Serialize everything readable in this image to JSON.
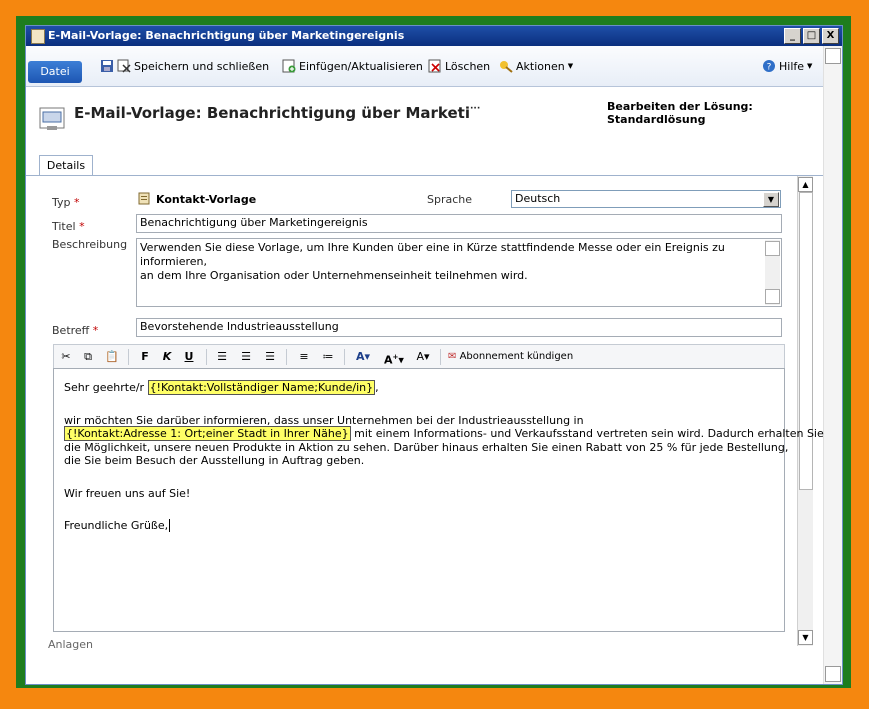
{
  "window": {
    "title": "E-Mail-Vorlage: Benachrichtigung über Marketingereignis",
    "controls": [
      "_",
      "□",
      "X"
    ]
  },
  "ribbon": {
    "file_tab": "Datei",
    "save_close": "Speichern und schließen",
    "insert_update": "Einfügen/Aktualisieren",
    "delete": "Löschen",
    "actions": "Aktionen",
    "help": "Hilfe"
  },
  "form": {
    "title": "E-Mail-Vorlage: Benachrichtigung über Marketi",
    "title_ellipsis": "···",
    "solution": "Bearbeiten der Lösung: Standardlösung",
    "tab": "Details"
  },
  "fields": {
    "type_label": "Typ",
    "type_value": "Kontakt-Vorlage",
    "language_label": "Sprache",
    "language_value": "Deutsch",
    "title_label": "Titel",
    "title_value": "Benachrichtigung über Marketingereignis",
    "description_label": "Beschreibung",
    "description_line1": "Verwenden Sie diese Vorlage, um Ihre Kunden über eine in Kürze stattfindende Messe oder ein Ereignis zu informieren,",
    "description_line2": "an dem Ihre Organisation oder Unternehmenseinheit teilnehmen wird.",
    "subject_label": "Betreff",
    "subject_value": "Bevorstehende Industrieausstellung",
    "required_marker": "*"
  },
  "editor_toolbar": {
    "bold": "F",
    "italic": "K",
    "underline": "U",
    "unsubscribe": "Abonnement kündigen"
  },
  "body": {
    "greeting_prefix": "Sehr geehrte/r ",
    "greeting_field": "{!Kontakt:Vollständiger Name;Kunde/in}",
    "greeting_suffix": ",",
    "line1": "wir möchten Sie darüber informieren, dass unser Unternehmen bei der Industrieausstellung in",
    "line2_field": "{!Kontakt:Adresse 1: Ort;einer Stadt in Ihrer Nähe}",
    "line2_rest": " mit einem Informations- und Verkaufsstand vertreten sein wird. Dadurch erhalten Sie",
    "line3": "die Möglichkeit, unsere neuen Produkte in Aktion zu sehen. Darüber hinaus erhalten Sie einen Rabatt von 25 % für jede Bestellung,",
    "line4": "die Sie beim Besuch der Ausstellung in Auftrag geben.",
    "closing1": "Wir freuen uns auf Sie!",
    "closing2": "Freundliche Grüße,"
  },
  "section_below": "Anlagen"
}
